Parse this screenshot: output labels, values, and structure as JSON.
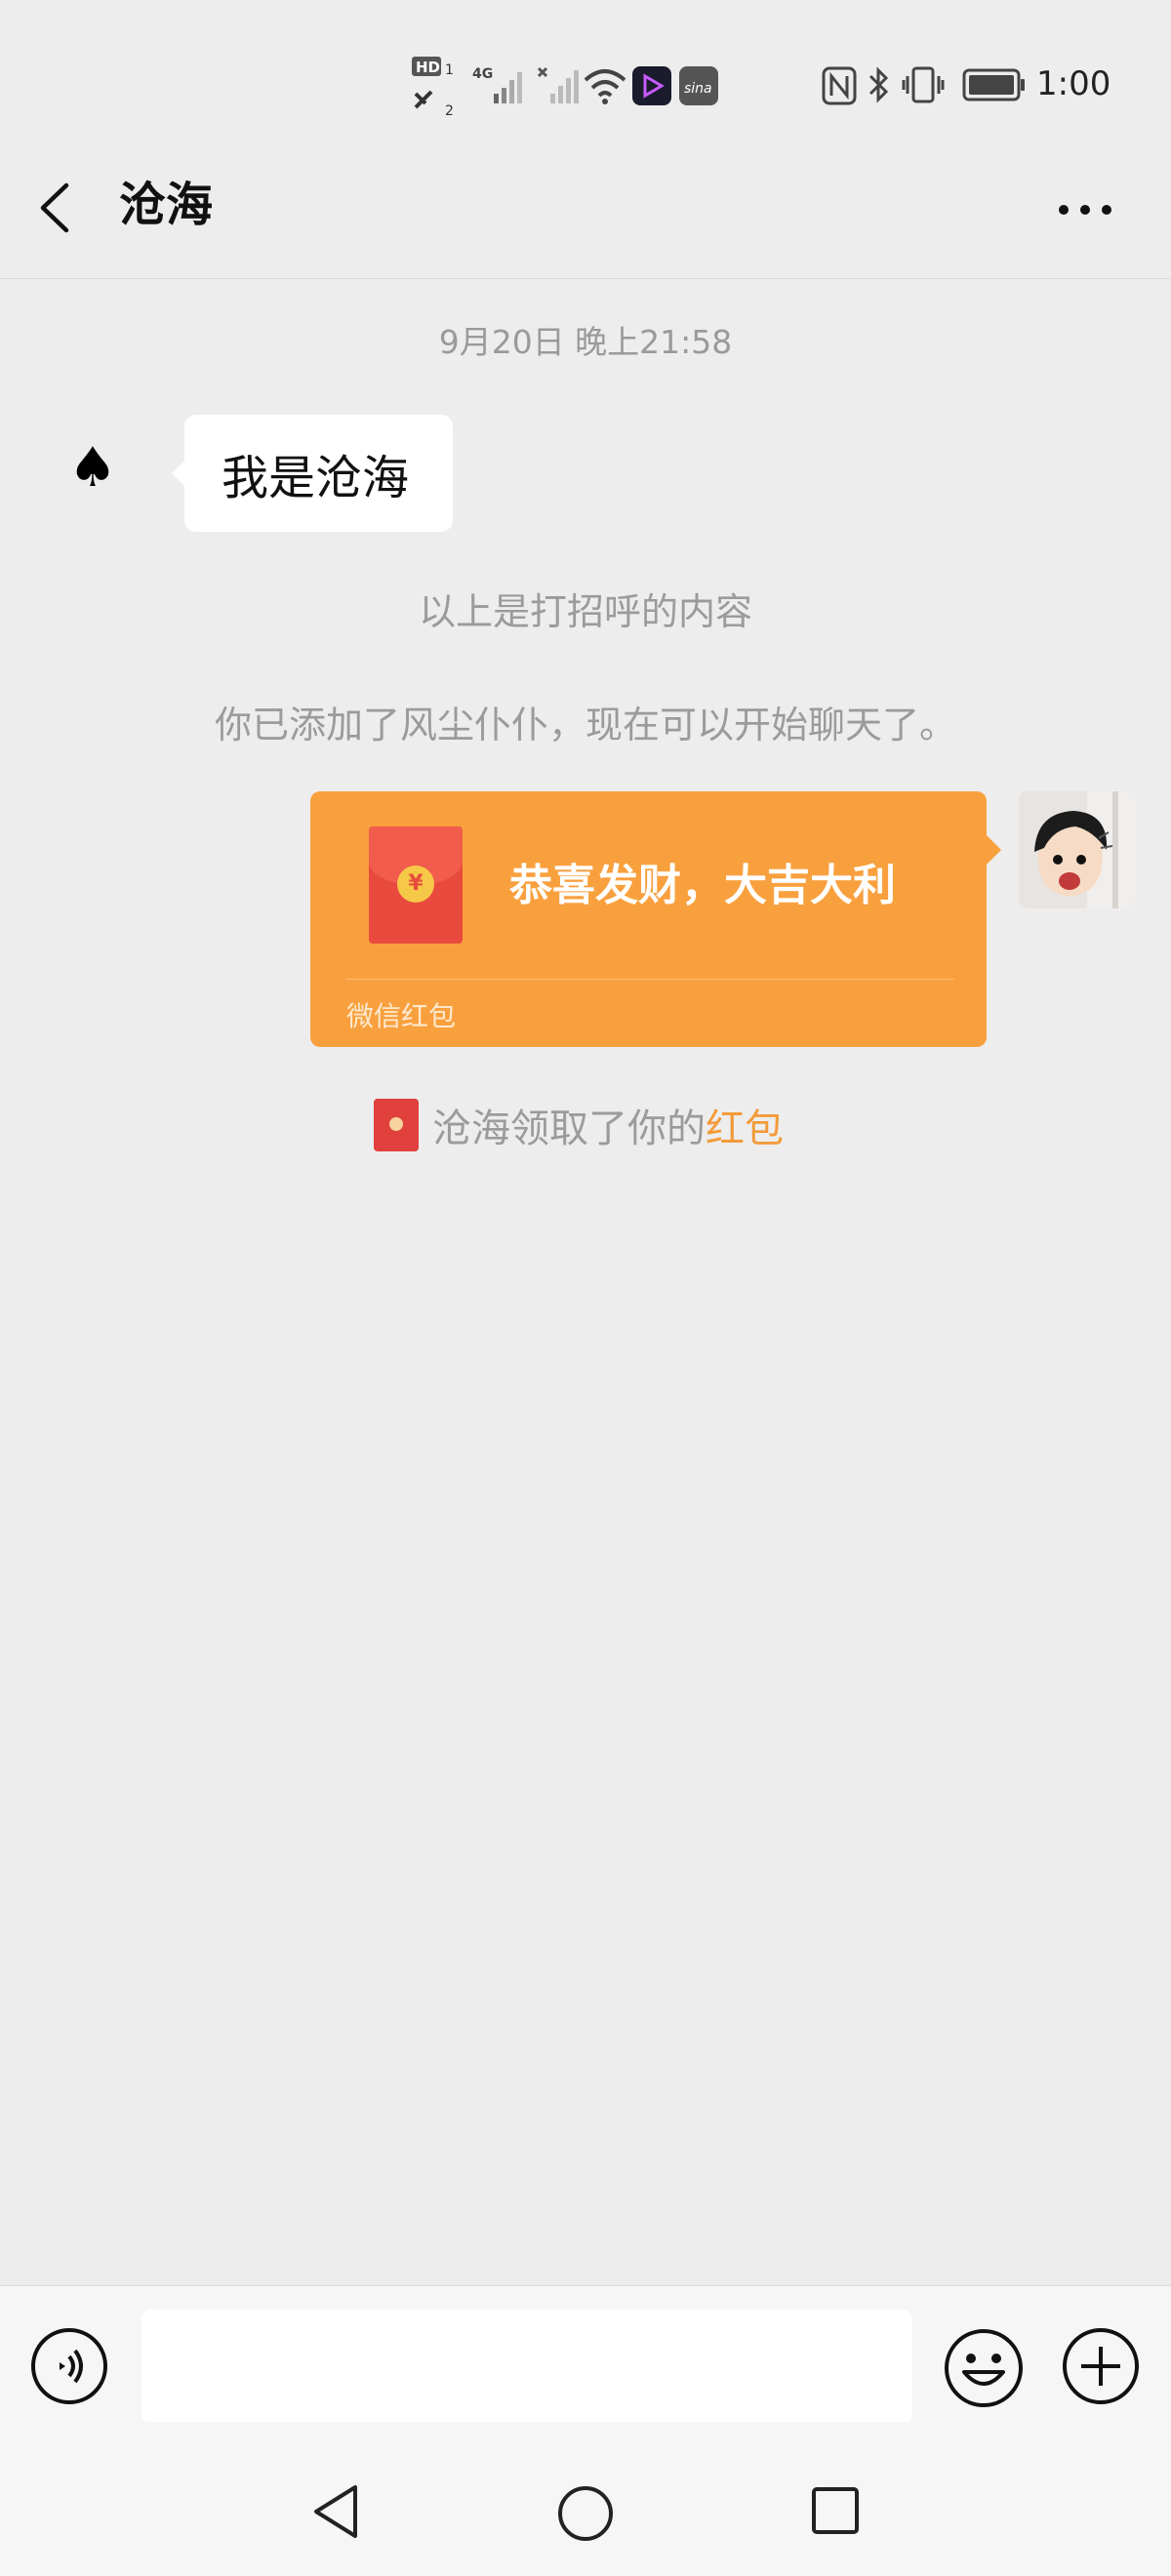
{
  "status_bar": {
    "time": "1:00",
    "network_label": "4G",
    "hd_label": "HD",
    "icons": [
      "hd-call-icon",
      "signal-icon",
      "signal-off-icon",
      "wifi-icon",
      "video-app-icon",
      "weibo-app-icon",
      "nfc-icon",
      "bluetooth-icon",
      "vibrate-icon",
      "battery-icon"
    ]
  },
  "header": {
    "title": "沧海",
    "back_icon": "chevron-left-icon",
    "more_icon": "more-horizontal-icon"
  },
  "chat": {
    "timestamp": "9月20日 晚上21:58",
    "incoming_message": "我是沧海",
    "incoming_avatar_symbol": "♠",
    "system_greeting_note": "以上是打招呼的内容",
    "system_added_note": "你已添加了风尘仆仆，现在可以开始聊天了。",
    "red_packet": {
      "message": "恭喜发财，大吉大利",
      "footer": "微信红包",
      "coin_symbol": "¥",
      "color": "#f9a03e"
    },
    "receipt": {
      "text": "沧海领取了你的",
      "link": "红包",
      "link_color": "#f39b3a"
    }
  },
  "input_bar": {
    "value": "",
    "icons": [
      "voice-icon",
      "emoji-icon",
      "plus-icon"
    ]
  },
  "nav_bar": {
    "icons": [
      "nav-back-icon",
      "nav-home-icon",
      "nav-recent-icon"
    ]
  }
}
